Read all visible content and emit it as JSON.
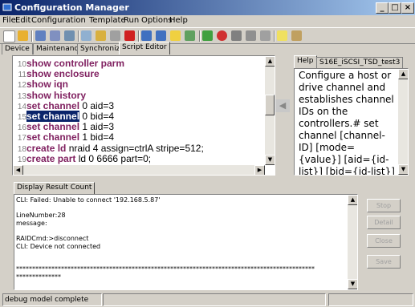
{
  "window": {
    "title": "Configuration Manager",
    "controls": [
      "_",
      "□",
      "×"
    ]
  },
  "menu": [
    "File",
    "Edit",
    "Configuration",
    "Template",
    "Run",
    "Options",
    "Help"
  ],
  "tabs": [
    "Device",
    "Maintenance",
    "Synchronize",
    "Script Editor"
  ],
  "editor_lines": [
    {
      "n": "10",
      "kw": "show controller parm",
      "rest": ""
    },
    {
      "n": "11",
      "kw": "show enclosure",
      "rest": ""
    },
    {
      "n": "12",
      "kw": "show iqn",
      "rest": ""
    },
    {
      "n": "13",
      "kw": "show history",
      "rest": ""
    },
    {
      "n": "14",
      "kw": "set channel",
      "rest": " 0 aid=3"
    },
    {
      "n": "15",
      "kw": "set channel",
      "rest": " 0 bid=4"
    },
    {
      "n": "16",
      "kw": "set channel",
      "rest": " 1 aid=3"
    },
    {
      "n": "17",
      "kw": "set channel",
      "rest": " 1 bid=4"
    },
    {
      "n": "18",
      "kw": "create ld",
      "rest": " nraid 4 assign=ctrlA stripe=512;"
    },
    {
      "n": "19",
      "kw": "create part",
      "rest": " ld 0 6666 part=0;"
    }
  ],
  "help": {
    "tabs": [
      "Help",
      "S16E_iSCSI_TSD_test3"
    ],
    "text": "Configure a host or drive channel and establishes channel IDs on the controllers.# set channel [channel-ID] [mode={value}] [aid={id-list}] [bid={id-list}] [maxrate={value}] [-r]"
  },
  "result": {
    "tab": "Display Result Count",
    "lines": [
      "CLI: Failed: Unable to connect '192.168.5.87'",
      "",
      "LineNumber:28",
      "message:",
      "",
      "RAIDCmd:>disconnect",
      "CLI: Device not connected",
      "",
      "",
      "*********************************************************************************************",
      "**************"
    ]
  },
  "buttons": [
    "Stop",
    "Detail",
    "Close",
    "Save"
  ],
  "status": {
    "text": "debug model complete"
  },
  "colors": {
    "keyword": "#7f1f5f",
    "selection": "#0a246a",
    "titlebar": "#0a246a"
  }
}
